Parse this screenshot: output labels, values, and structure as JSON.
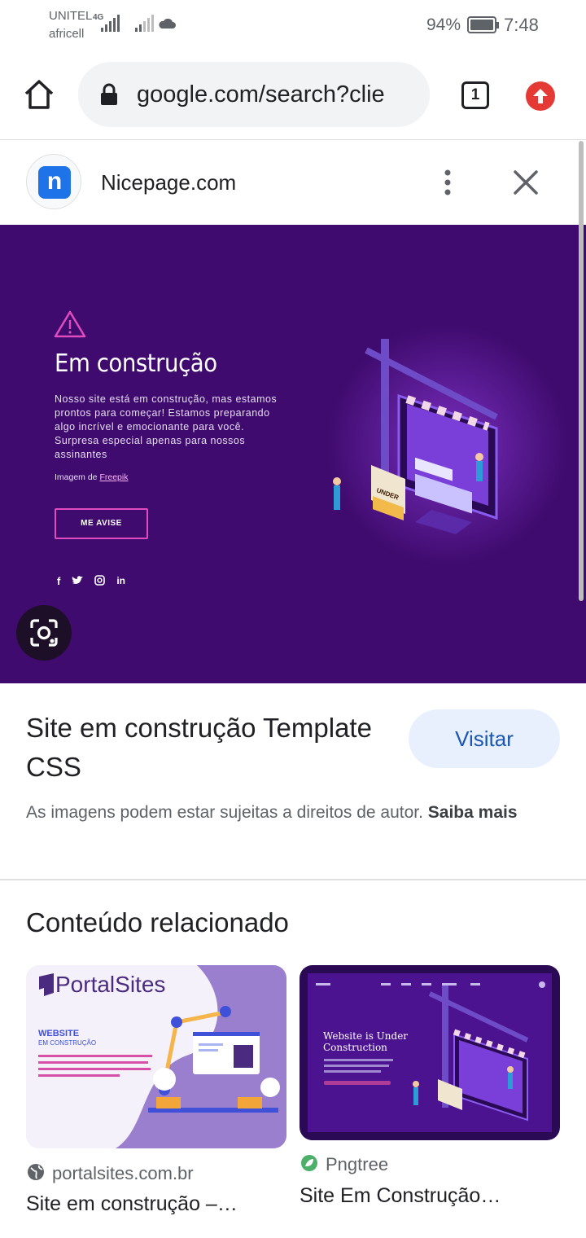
{
  "status_bar": {
    "carrier1": "UNITEL",
    "carrier2": "africell",
    "network": "4G",
    "battery": "94%",
    "time": "7:48"
  },
  "browser": {
    "url": "google.com/search?clie",
    "tab_count": "1"
  },
  "viewer": {
    "site_logo_letter": "n",
    "site_name": "Nicepage.com"
  },
  "hero": {
    "title": "Em construção",
    "text": "Nosso site está em construção, mas estamos prontos para começar! Estamos preparando algo incrível e emocionante para você. Surpresa especial apenas para nossos assinantes",
    "credit_prefix": "Imagem de",
    "credit_link": "Freepik",
    "button": "ME AVISE",
    "sign_text": "UNDER"
  },
  "result": {
    "title": "Site em construção Template CSS",
    "visit_button": "Visitar",
    "copyright_text": "As imagens podem estar sujeitas a direitos de autor.",
    "copyright_link": "Saiba mais"
  },
  "related": {
    "heading": "Conteúdo relacionado",
    "cards": [
      {
        "source": "portalsites.com.br",
        "caption": "Site em construção –…",
        "thumb_brand": "PortalSites",
        "thumb_title": "WEBSITE",
        "thumb_subtitle": "EM CONSTRUÇÃO"
      },
      {
        "source": "Pngtree",
        "caption": "Site Em Construção…",
        "thumb_title": "Website is Under Construction"
      }
    ]
  },
  "colors": {
    "hero_bg": "#3f0b6e",
    "accent_pink": "#e04bc0",
    "visit_bg": "#e8f0fe",
    "visit_text": "#1a57b0"
  }
}
